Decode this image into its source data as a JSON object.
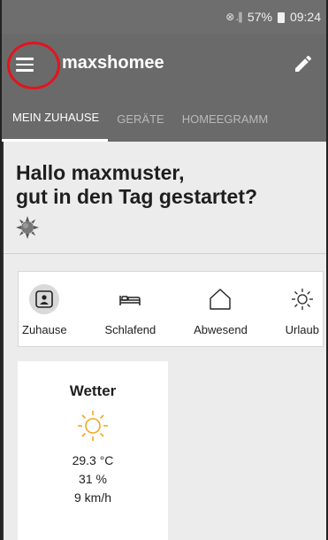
{
  "status_bar": {
    "signal": "⊗ .∥",
    "battery": "57%",
    "time": "09:24"
  },
  "app_bar": {
    "title": "maxshomee",
    "menu_icon": "hamburger-menu-icon",
    "edit_icon": "pencil-icon"
  },
  "tabs": [
    {
      "label": "MEIN ZUHAUSE",
      "active": true
    },
    {
      "label": "GERÄTE",
      "active": false
    },
    {
      "label": "HOMEEGRAMM",
      "active": false
    }
  ],
  "greeting": {
    "line1": "Hallo maxmuster,",
    "line2": "gut in den Tag gestartet?",
    "icon": "sun-dim-icon"
  },
  "modes": [
    {
      "label": "Zuhause",
      "icon": "home-person-icon",
      "active": true
    },
    {
      "label": "Schlafend",
      "icon": "bed-icon",
      "active": false
    },
    {
      "label": "Abwesend",
      "icon": "house-outline-icon",
      "active": false
    },
    {
      "label": "Urlaub",
      "icon": "sun-outline-icon",
      "active": false
    }
  ],
  "weather": {
    "title": "Wetter",
    "icon": "sun-icon",
    "temperature": "29.3 °C",
    "humidity": "31 %",
    "wind": "9 km/h"
  },
  "colors": {
    "appbar": "#6a6a6a",
    "accent_ring": "#e3141d",
    "sun_orange": "#f5a623",
    "background": "#ececec"
  }
}
